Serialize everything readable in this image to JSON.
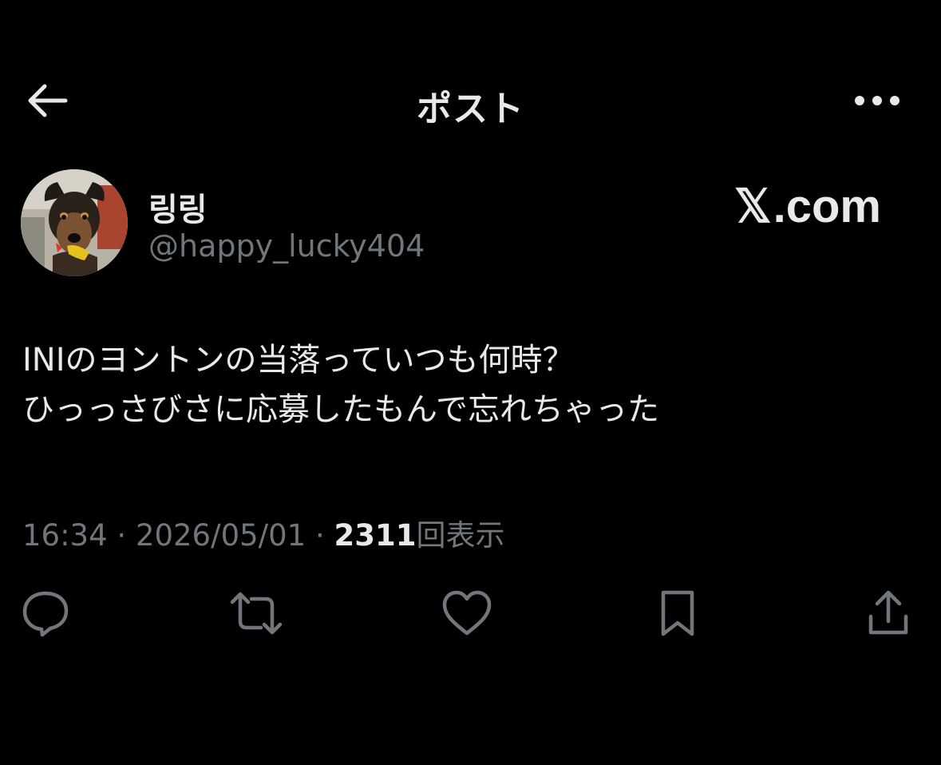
{
  "header": {
    "title": "ポスト",
    "back_icon": "arrow-left-icon",
    "more_icon": "more-horizontal-icon"
  },
  "author": {
    "display_name": "링링",
    "handle": "@happy_lucky404",
    "avatar_icon": "dog-avatar"
  },
  "watermark": {
    "x_glyph": "𝕏",
    "domain": ".com"
  },
  "tweet": {
    "lines": [
      "INIのヨントンの当落っていつも何時？",
      "ひっっさびさに応募したもんで忘れちゃった"
    ]
  },
  "meta": {
    "time": "16:34",
    "separator": " · ",
    "date": "2026/05/01",
    "views_count": "2311",
    "views_label": "回表示"
  },
  "actions": {
    "items": [
      {
        "icon": "reply-icon"
      },
      {
        "icon": "repost-icon"
      },
      {
        "icon": "like-icon"
      },
      {
        "icon": "bookmark-icon"
      },
      {
        "icon": "share-icon"
      }
    ]
  },
  "colors": {
    "background": "#000000",
    "primary_text": "#e7e9ea",
    "secondary_text": "#71767b"
  }
}
